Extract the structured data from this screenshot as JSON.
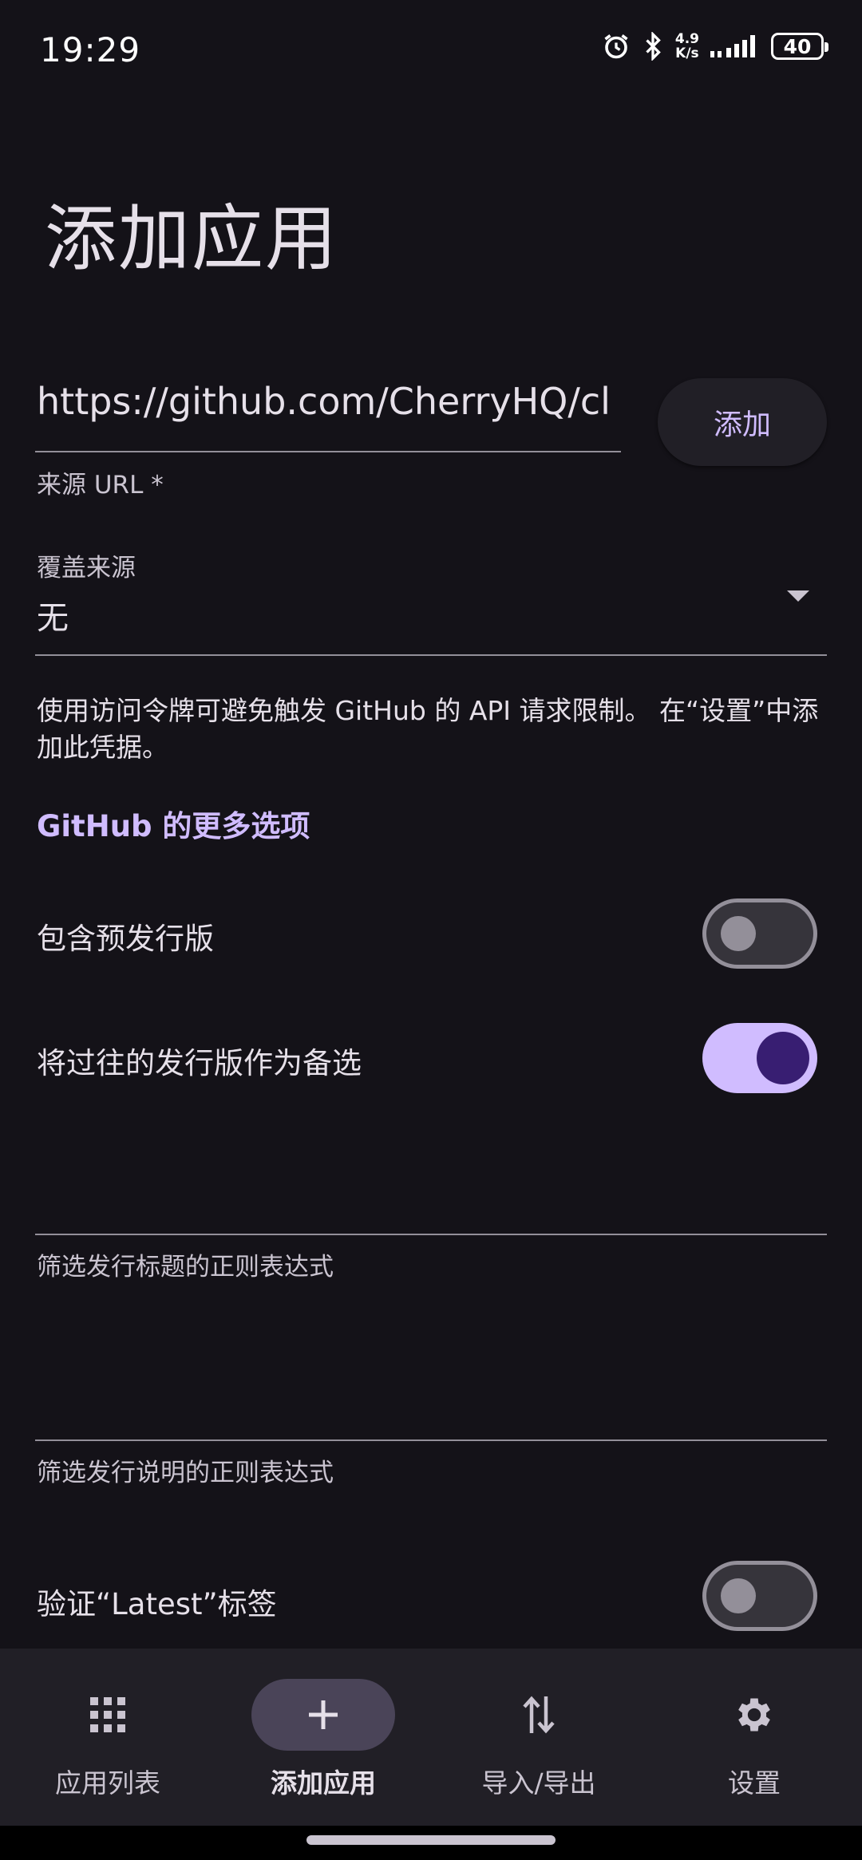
{
  "status_bar": {
    "time": "19:29",
    "net_speed_value": "4.9",
    "net_speed_unit": "K/s",
    "battery": "40",
    "icons": [
      "alarm-icon",
      "bluetooth-icon",
      "signal-icon",
      "battery-icon"
    ]
  },
  "page": {
    "title": "添加应用"
  },
  "source_url": {
    "value": "https://github.com/CherryHQ/cl",
    "label": "来源 URL *",
    "add_button": "添加"
  },
  "override_source": {
    "label": "覆盖来源",
    "value": "无"
  },
  "hint": "使用访问令牌可避免触发 GitHub 的 API 请求限制。 在“设置”中添加此凭据。",
  "more_options_link": "GitHub 的更多选项",
  "toggles": [
    {
      "label": "包含预发行版",
      "on": false
    },
    {
      "label": "将过往的发行版作为备选",
      "on": true
    },
    {
      "label": "验证“Latest”标签",
      "on": false
    }
  ],
  "regex_fields": {
    "title_label": "筛选发行标题的正则表达式",
    "notes_label": "筛选发行说明的正则表达式"
  },
  "bottom_nav": {
    "items": [
      {
        "label": "应用列表",
        "icon": "grid-icon",
        "active": false
      },
      {
        "label": "添加应用",
        "icon": "plus-icon",
        "active": true
      },
      {
        "label": "导入/导出",
        "icon": "swap-vertical-icon",
        "active": false
      },
      {
        "label": "设置",
        "icon": "gear-icon",
        "active": false
      }
    ]
  },
  "colors": {
    "background": "#141218",
    "accent": "#d0bcff",
    "nav_background": "#211f26"
  }
}
